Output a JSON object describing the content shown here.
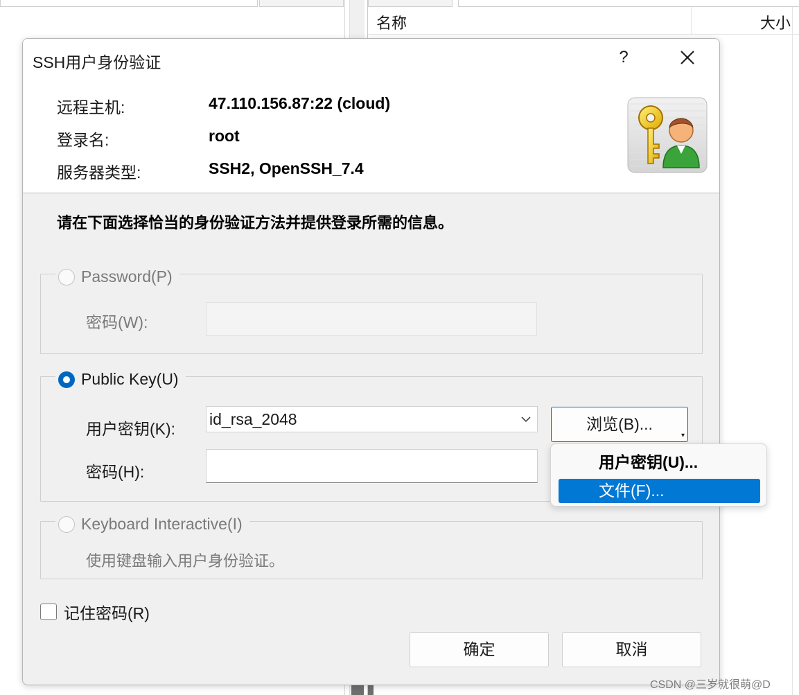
{
  "background_app": {
    "column_name": "名称",
    "column_size": "大小"
  },
  "dialog": {
    "title": "SSH用户身份验证",
    "help_label": "?",
    "info": [
      {
        "label": "远程主机:",
        "value": "47.110.156.87:22 (cloud)"
      },
      {
        "label": "登录名:",
        "value": "root"
      },
      {
        "label": "服务器类型:",
        "value": "SSH2, OpenSSH_7.4"
      }
    ],
    "instruction": "请在下面选择恰当的身份验证方法并提供登录所需的信息。",
    "password_group": {
      "label": "Password(P)",
      "selected": false,
      "enabled": false,
      "field_label": "密码(W):",
      "field_value": ""
    },
    "publickey_group": {
      "label": "Public Key(U)",
      "selected": true,
      "user_key_label": "用户密钥(K):",
      "user_key_value": "id_rsa_2048",
      "passphrase_label": "密码(H):",
      "passphrase_value": "",
      "browse_label": "浏览(B)..."
    },
    "keyboard_group": {
      "label": "Keyboard Interactive(I)",
      "selected": false,
      "enabled": false,
      "description": "使用键盘输入用户身份验证。"
    },
    "remember_password_label": "记住密码(R)",
    "remember_password_checked": false,
    "ok_label": "确定",
    "cancel_label": "取消"
  },
  "browse_menu": {
    "items": [
      {
        "label": "用户密钥(U)...",
        "style": "bold"
      },
      {
        "label": "文件(F)...",
        "style": "selected"
      }
    ]
  },
  "colors": {
    "accent": "#0067c0",
    "menu_selected": "#0078d4",
    "dialog_bg": "#f0f0f0"
  },
  "icons": {
    "close": "close-x-icon",
    "hero": "key-user-icon",
    "combo": "chevron-down-icon"
  },
  "watermark": "CSDN @三岁就很萌@D"
}
